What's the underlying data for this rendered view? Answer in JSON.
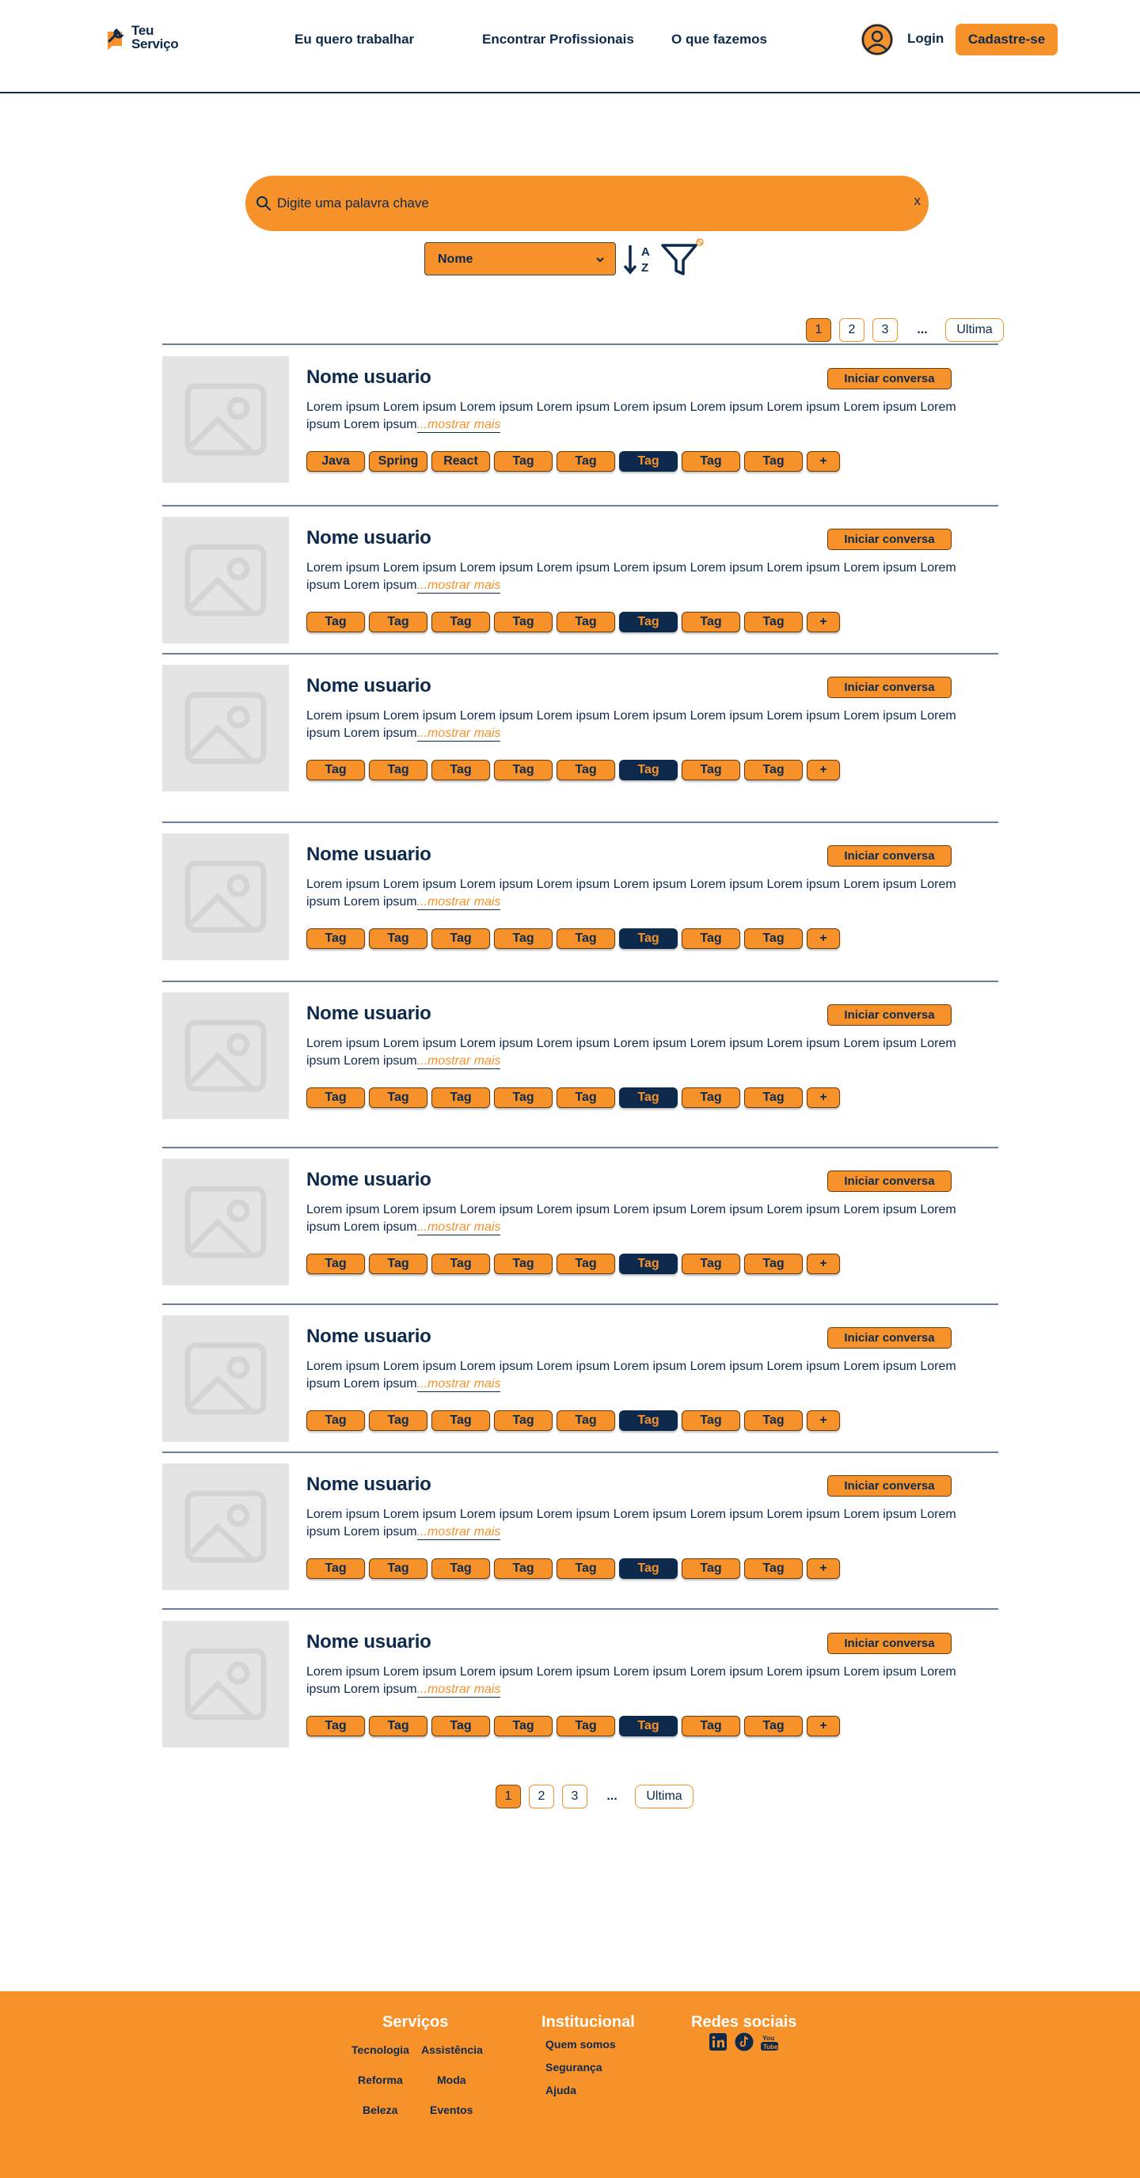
{
  "header": {
    "logo_line1": "Teu",
    "logo_line2": "Serviço",
    "nav": [
      "Eu quero trabalhar",
      "Encontrar Profissionais",
      "O que fazemos"
    ],
    "login": "Login",
    "signup": "Cadastre-se"
  },
  "search": {
    "placeholder": "Digite uma palavra chave",
    "clear": "x",
    "sort_select": "Nome"
  },
  "pagination": {
    "pages": [
      "1",
      "2",
      "3"
    ],
    "active": "1",
    "dots": "...",
    "last": "Ultima"
  },
  "cards": [
    {
      "name": "Nome usuario",
      "action": "Iniciar conversa",
      "description": "Lorem ipsum Lorem ipsum Lorem ipsum Lorem ipsum Lorem ipsum Lorem ipsum Lorem ipsum Lorem ipsum Lorem ipsum",
      "more": "...mostrar mais",
      "tags": [
        "Java",
        "Spring",
        "React",
        "Tag",
        "Tag",
        "Tag",
        "Tag",
        "Tag",
        "+"
      ]
    },
    {
      "name": "Nome usuario",
      "action": "Iniciar conversa",
      "description": "Lorem ipsum Lorem ipsum Lorem ipsum Lorem ipsum Lorem ipsum Lorem ipsum Lorem ipsum Lorem ipsum Lorem ipsum",
      "more": "...mostrar mais",
      "tags": [
        "Tag",
        "Tag",
        "Tag",
        "Tag",
        "Tag",
        "Tag",
        "Tag",
        "Tag",
        "+"
      ]
    },
    {
      "name": "Nome usuario",
      "action": "Iniciar conversa",
      "description": "Lorem ipsum Lorem ipsum Lorem ipsum Lorem ipsum Lorem ipsum Lorem ipsum Lorem ipsum Lorem ipsum Lorem ipsum",
      "more": "...mostrar mais",
      "tags": [
        "Tag",
        "Tag",
        "Tag",
        "Tag",
        "Tag",
        "Tag",
        "Tag",
        "Tag",
        "+"
      ]
    },
    {
      "name": "Nome usuario",
      "action": "Iniciar conversa",
      "description": "Lorem ipsum Lorem ipsum Lorem ipsum Lorem ipsum Lorem ipsum Lorem ipsum Lorem ipsum Lorem ipsum Lorem ipsum",
      "more": "...mostrar mais",
      "tags": [
        "Tag",
        "Tag",
        "Tag",
        "Tag",
        "Tag",
        "Tag",
        "Tag",
        "Tag",
        "+"
      ]
    },
    {
      "name": "Nome usuario",
      "action": "Iniciar conversa",
      "description": "Lorem ipsum Lorem ipsum Lorem ipsum Lorem ipsum Lorem ipsum Lorem ipsum Lorem ipsum Lorem ipsum Lorem ipsum",
      "more": "...mostrar mais",
      "tags": [
        "Tag",
        "Tag",
        "Tag",
        "Tag",
        "Tag",
        "Tag",
        "Tag",
        "Tag",
        "+"
      ]
    },
    {
      "name": "Nome usuario",
      "action": "Iniciar conversa",
      "description": "Lorem ipsum Lorem ipsum Lorem ipsum Lorem ipsum Lorem ipsum Lorem ipsum Lorem ipsum Lorem ipsum Lorem ipsum",
      "more": "...mostrar mais",
      "tags": [
        "Tag",
        "Tag",
        "Tag",
        "Tag",
        "Tag",
        "Tag",
        "Tag",
        "Tag",
        "+"
      ]
    },
    {
      "name": "Nome usuario",
      "action": "Iniciar conversa",
      "description": "Lorem ipsum Lorem ipsum Lorem ipsum Lorem ipsum Lorem ipsum Lorem ipsum Lorem ipsum Lorem ipsum Lorem ipsum",
      "more": "...mostrar mais",
      "tags": [
        "Tag",
        "Tag",
        "Tag",
        "Tag",
        "Tag",
        "Tag",
        "Tag",
        "Tag",
        "+"
      ]
    },
    {
      "name": "Nome usuario",
      "action": "Iniciar conversa",
      "description": "Lorem ipsum Lorem ipsum Lorem ipsum Lorem ipsum Lorem ipsum Lorem ipsum Lorem ipsum Lorem ipsum Lorem ipsum",
      "more": "...mostrar mais",
      "tags": [
        "Tag",
        "Tag",
        "Tag",
        "Tag",
        "Tag",
        "Tag",
        "Tag",
        "Tag",
        "+"
      ]
    },
    {
      "name": "Nome usuario",
      "action": "Iniciar conversa",
      "description": "Lorem ipsum Lorem ipsum Lorem ipsum Lorem ipsum Lorem ipsum Lorem ipsum Lorem ipsum Lorem ipsum Lorem ipsum",
      "more": "...mostrar mais",
      "tags": [
        "Tag",
        "Tag",
        "Tag",
        "Tag",
        "Tag",
        "Tag",
        "Tag",
        "Tag",
        "+"
      ]
    }
  ],
  "highlighted_tag_index": 5,
  "footer": {
    "servicos_title": "Serviços",
    "servicos": [
      "Tecnologia",
      "Assistência",
      "Reforma",
      "Moda",
      "Beleza",
      "Eventos"
    ],
    "institucional_title": "Institucional",
    "institucional": [
      "Quem somos",
      "Segurança",
      "Ajuda"
    ],
    "redes_title": "Redes sociais",
    "redes": [
      "linkedin-icon",
      "tiktok-icon",
      "youtube-icon"
    ]
  },
  "colors": {
    "accent": "#f7922a",
    "navy": "#0d2a4d",
    "placeholder_gray": "#e4e4e4"
  }
}
